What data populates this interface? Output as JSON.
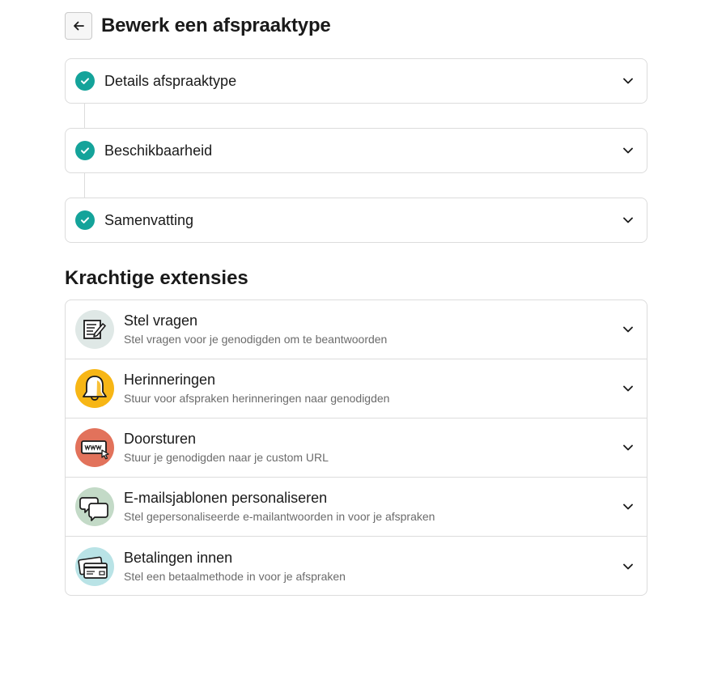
{
  "header": {
    "title": "Bewerk een afspraaktype",
    "back_icon": "arrow-left-icon"
  },
  "colors": {
    "check": "#14a39a",
    "border": "#dcdcdc",
    "muted": "#6b6b6b"
  },
  "steps": [
    {
      "label": "Details afspraaktype",
      "status": "completed"
    },
    {
      "label": "Beschikbaarheid",
      "status": "completed"
    },
    {
      "label": "Samenvatting",
      "status": "completed"
    }
  ],
  "extensions": {
    "title": "Krachtige extensies",
    "items": [
      {
        "title": "Stel vragen",
        "description": "Stel vragen voor je genodigden om te beantwoorden",
        "icon": "form-edit-icon",
        "icon_bg": "#dfe8e6"
      },
      {
        "title": "Herinneringen",
        "description": "Stuur voor afspraken herinneringen naar genodigden",
        "icon": "bell-icon",
        "icon_bg": "#f7b615"
      },
      {
        "title": "Doorsturen",
        "description": "Stuur je genodigden naar je custom URL",
        "icon": "www-redirect-icon",
        "icon_bg": "#e2725b"
      },
      {
        "title": "E-mailsjablonen personaliseren",
        "description": "Stel gepersonaliseerde e-mailantwoorden in voor je afspraken",
        "icon": "chat-bubbles-icon",
        "icon_bg": "#c3dac7"
      },
      {
        "title": "Betalingen innen",
        "description": "Stel een betaalmethode in voor je afspraken",
        "icon": "credit-cards-icon",
        "icon_bg": "#b9e3e6"
      }
    ]
  }
}
